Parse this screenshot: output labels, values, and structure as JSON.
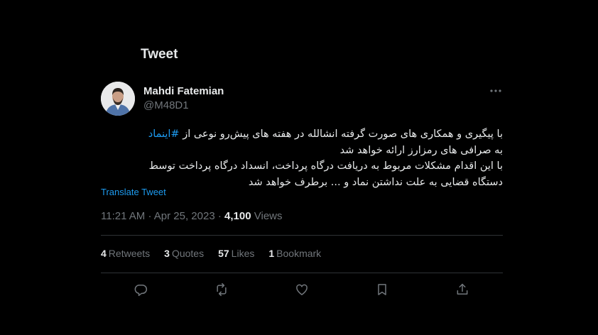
{
  "header": {
    "title": "Tweet"
  },
  "author": {
    "name": "Mahdi Fatemian",
    "handle": "@M48D1"
  },
  "tweet": {
    "line1_text": "با پیگیری و همکاری های صورت گرفته انشالله در هفته های پیش‌رو نوعی از",
    "hashtag": "#اینماد",
    "line2": "به صرافی های رمزارز ارائه خواهد شد",
    "line3": "با این اقدام مشکلات مربوط به دریافت درگاه پرداخت، انسداد درگاه پرداخت توسط",
    "line4": "دستگاه قضایی به علت نداشتن نماد و ... برطرف خواهد شد"
  },
  "translate_label": "Translate Tweet",
  "meta": {
    "time": "11:21 AM",
    "separator": "·",
    "date": "Apr 25, 2023",
    "views_count": "4,100",
    "views_label": "Views"
  },
  "stats": {
    "retweets": {
      "count": "4",
      "label": "Retweets"
    },
    "quotes": {
      "count": "3",
      "label": "Quotes"
    },
    "likes": {
      "count": "57",
      "label": "Likes"
    },
    "bookmarks": {
      "count": "1",
      "label": "Bookmark"
    }
  },
  "icons": {
    "more": "more-dots-icon",
    "reply": "reply-icon",
    "retweet": "retweet-icon",
    "like": "heart-icon",
    "bookmark": "bookmark-icon",
    "share": "share-icon"
  },
  "colors": {
    "background": "#000000",
    "text": "#e7e9ea",
    "muted": "#71767b",
    "accent": "#1d9bf0",
    "divider": "#2f3336"
  }
}
